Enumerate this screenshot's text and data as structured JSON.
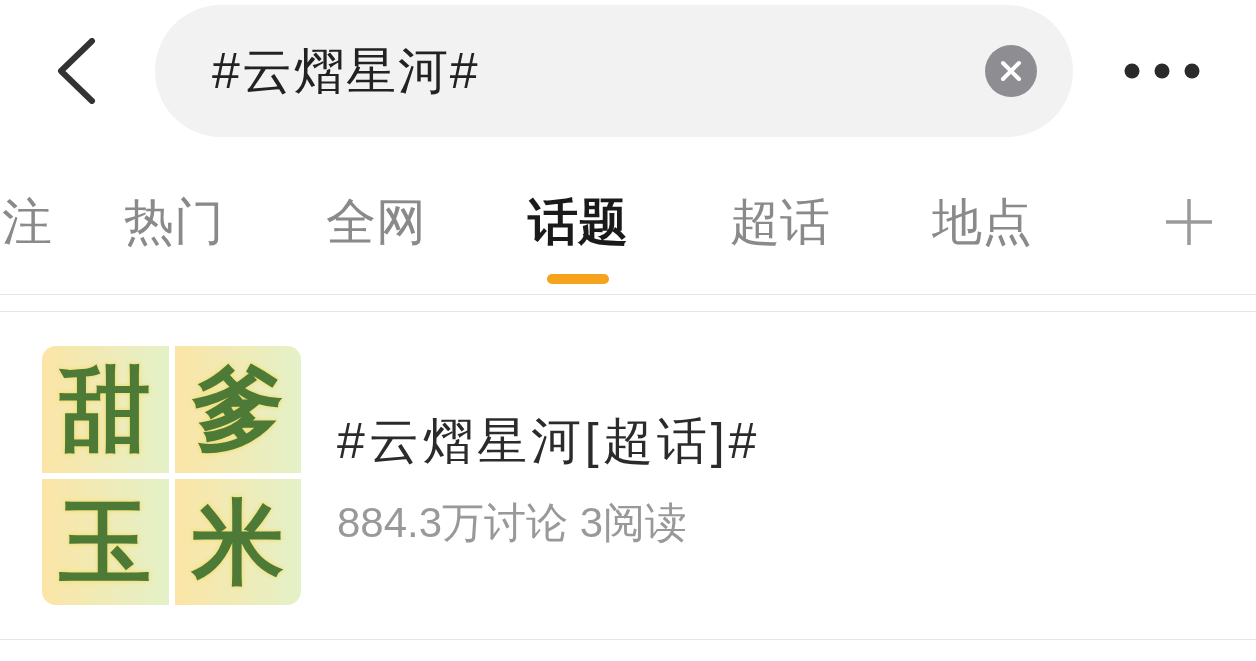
{
  "header": {
    "search": {
      "value": "#云熠星河#"
    }
  },
  "tabs": [
    {
      "label": "注",
      "selected": false
    },
    {
      "label": "热门",
      "selected": false
    },
    {
      "label": "全网",
      "selected": false
    },
    {
      "label": "话题",
      "selected": true
    },
    {
      "label": "超话",
      "selected": false
    },
    {
      "label": "地点",
      "selected": false
    }
  ],
  "results": [
    {
      "cover": {
        "tiles": [
          "甜",
          "爹",
          "玉",
          "米"
        ]
      },
      "title": "#云熠星河[超话]#",
      "stats": "884.3万讨论 3阅读"
    }
  ]
}
